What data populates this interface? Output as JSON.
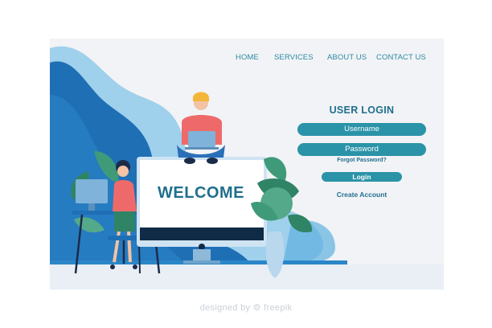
{
  "nav": {
    "items": [
      {
        "label": "HOME"
      },
      {
        "label": "SERVICES"
      },
      {
        "label": "ABOUT US"
      },
      {
        "label": "CONTACT US"
      }
    ]
  },
  "login": {
    "title": "USER LOGIN",
    "username_placeholder": "Username",
    "password_placeholder": "Password",
    "forgot_label": "Forgot Password?",
    "login_button": "Login",
    "create_account": "Create Account"
  },
  "hero": {
    "monitor_text": "WELCOME"
  },
  "footer": {
    "credit": "designed by ⚙ freepik"
  },
  "colors": {
    "accent": "#2a93a8",
    "heading": "#1f6f8e",
    "wave_dark": "#1f6fb5",
    "wave_light": "#9fd0ec"
  }
}
